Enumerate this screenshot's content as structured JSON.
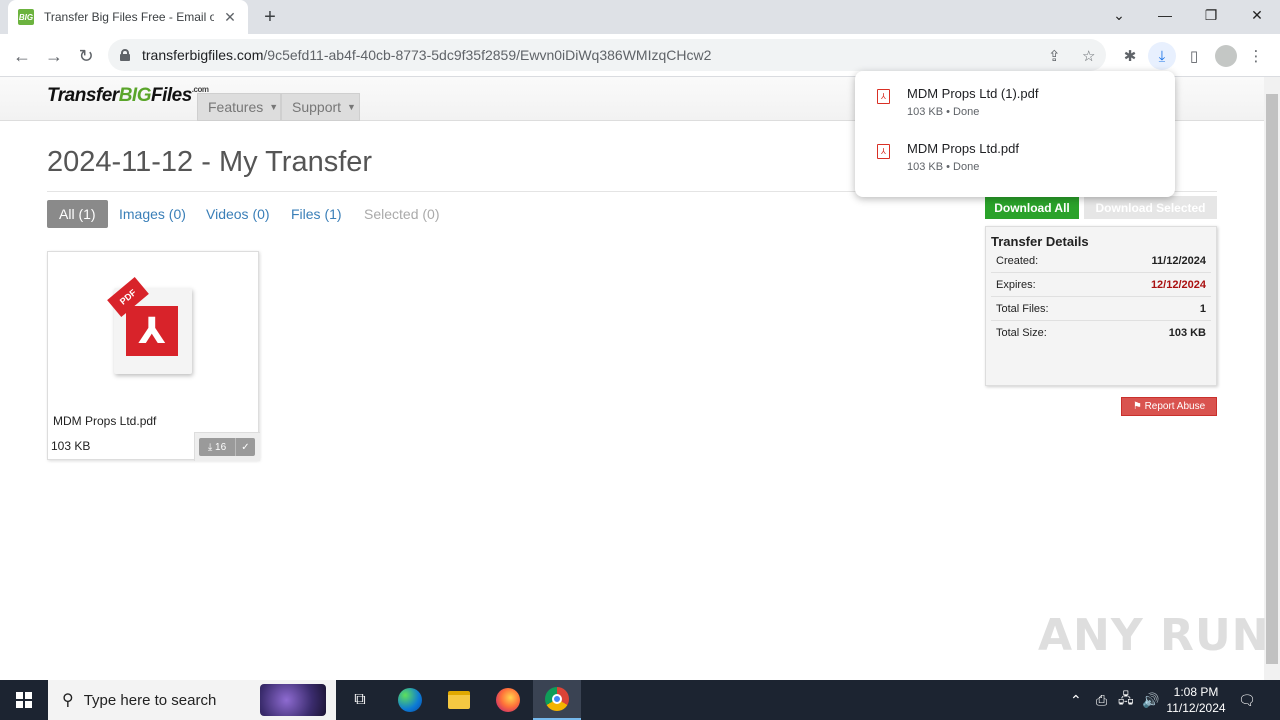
{
  "browser": {
    "tab_title": "Transfer Big Files Free - Email or",
    "tab_favicon_text": "BIG",
    "url_host": "transferbigfiles.com",
    "url_path": "/9c5efd11-ab4f-40cb-8773-5dc9f35f2859/Ewvn0iDiWq386WMIzqCHcw2"
  },
  "downloads": [
    {
      "name": "MDM Props Ltd (1).pdf",
      "status": "103 KB • Done"
    },
    {
      "name": "MDM Props Ltd.pdf",
      "status": "103 KB • Done"
    }
  ],
  "site": {
    "logo_a": "Transfer",
    "logo_b": "BIG",
    "logo_c": "Files",
    "logo_d": ".com",
    "nav": [
      {
        "label": "Features"
      },
      {
        "label": "Support"
      }
    ]
  },
  "page": {
    "title": "2024-11-12 - My Transfer",
    "filters": [
      {
        "label": "All (1)"
      },
      {
        "label": "Images (0)"
      },
      {
        "label": "Videos (0)"
      },
      {
        "label": "Files (1)"
      },
      {
        "label": "Selected (0)"
      }
    ],
    "file": {
      "name": "MDM Props Ltd.pdf",
      "size": "103 KB",
      "download_count": "16",
      "icon_text": "PDF"
    },
    "download_all": "Download All",
    "download_selected": "Download Selected",
    "details": {
      "title": "Transfer Details",
      "rows": [
        {
          "label": "Created:",
          "value": "11/12/2024"
        },
        {
          "label": "Expires:",
          "value": "12/12/2024"
        },
        {
          "label": "Total Files:",
          "value": "1"
        },
        {
          "label": "Total Size:",
          "value": "103 KB"
        }
      ]
    },
    "report_abuse": "Report Abuse"
  },
  "watermark": "ANY RUN",
  "taskbar": {
    "search_placeholder": "Type here to search",
    "time": "1:08 PM",
    "date": "11/12/2024"
  },
  "colors": {
    "accent_green": "#2aa22a",
    "link_blue": "#3a7fb8",
    "expires_red": "#aa1111",
    "report_red": "#d9534f"
  }
}
